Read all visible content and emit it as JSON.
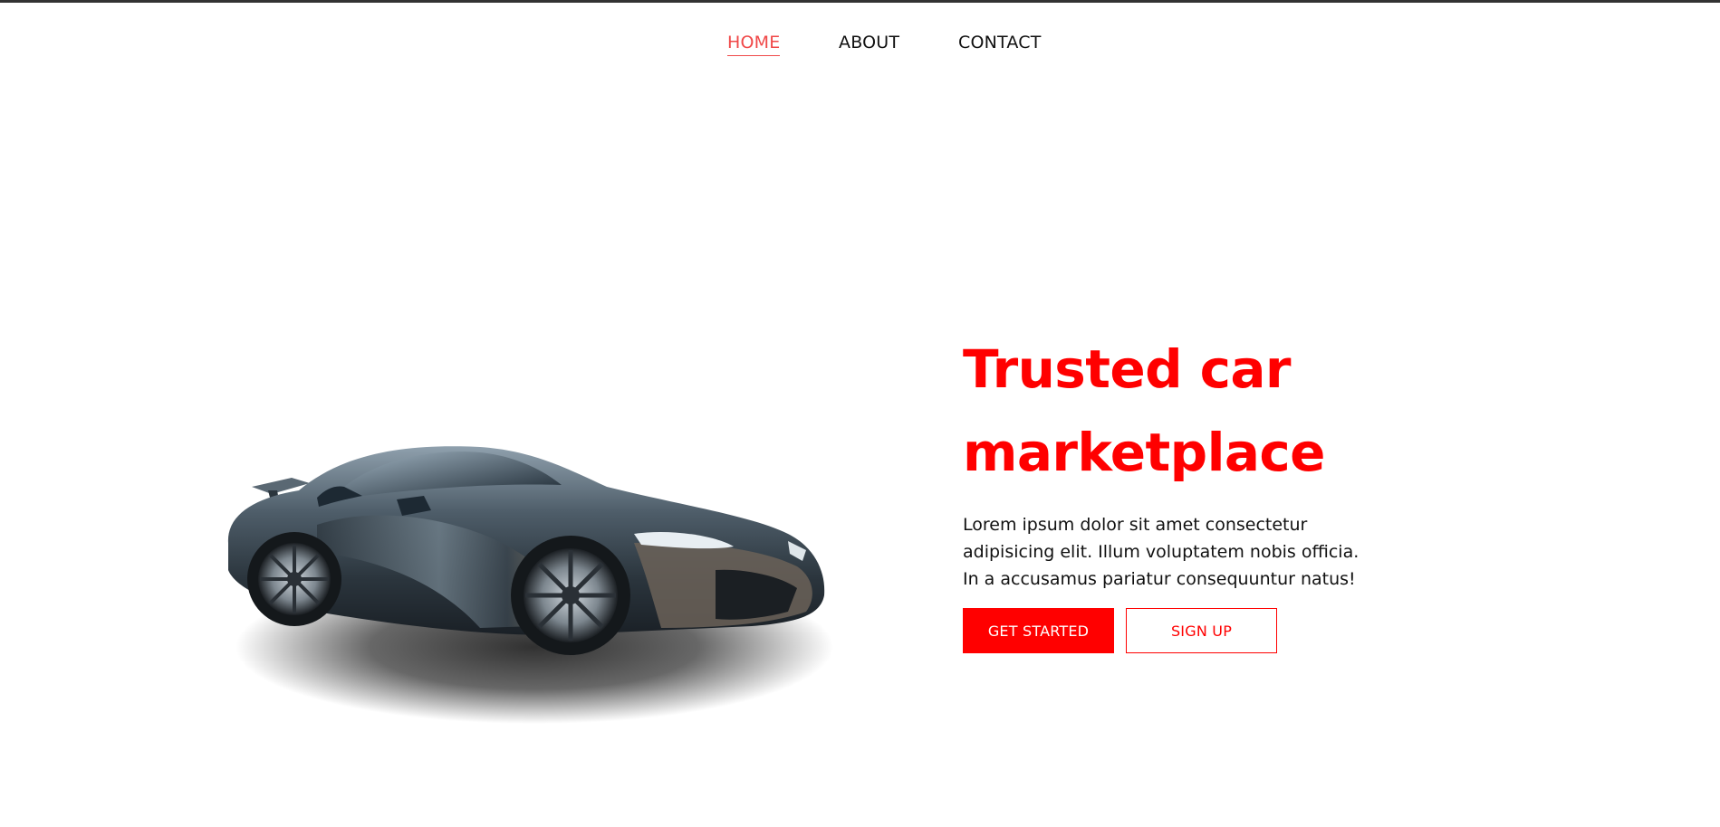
{
  "nav": {
    "items": [
      {
        "label": "HOME",
        "active": true
      },
      {
        "label": "ABOUT",
        "active": false
      },
      {
        "label": "CONTACT",
        "active": false
      }
    ]
  },
  "hero": {
    "headline_lines": [
      "Trusted car",
      "marketplace"
    ],
    "description_lines": [
      "Lorem ipsum dolor sit amet consectetur",
      "adipisicing elit. Illum voluptatem nobis officia.",
      "In a accusamus pariatur consequuntur natus!"
    ],
    "primary_button": "GET STARTED",
    "secondary_button": "SIGN UP",
    "image": "sports-car-image"
  },
  "colors": {
    "accent": "#ff0000",
    "nav_active": "#f04848",
    "text": "#111111",
    "background": "#ffffff"
  }
}
